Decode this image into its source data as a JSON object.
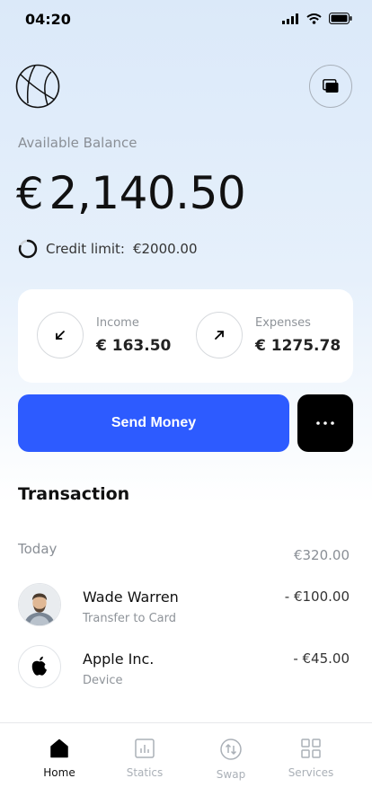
{
  "status_bar": {
    "time": "04:20"
  },
  "header": {
    "logo_icon": "globe-icon",
    "cards_icon": "cards-icon"
  },
  "balance": {
    "label": "Available Balance",
    "currency": "€",
    "amount": "2,140.50"
  },
  "credit": {
    "label": "Credit limit:",
    "value": "€2000.00",
    "progress_fraction": 0.8
  },
  "summary": {
    "income": {
      "label": "Income",
      "value": "€ 163.50",
      "icon": "arrow-down-left-icon"
    },
    "expenses": {
      "label": "Expenses",
      "value": "€ 1275.78",
      "icon": "arrow-up-right-icon"
    }
  },
  "actions": {
    "send_label": "Send Money",
    "more_icon": "more-dots-icon",
    "accent_color": "#2d5bff"
  },
  "transactions": {
    "title": "Transaction",
    "day_label": "Today",
    "day_total": "€320.00",
    "items": [
      {
        "name": "Wade Warren",
        "subtitle": "Transfer to Card",
        "amount": "- €100.00",
        "icon": "person-avatar"
      },
      {
        "name": "Apple Inc.",
        "subtitle": "Device",
        "amount": "- €45.00",
        "icon": "apple-icon"
      }
    ]
  },
  "nav": {
    "items": [
      {
        "label": "Home",
        "icon": "home-icon",
        "active": true
      },
      {
        "label": "Statics",
        "icon": "chart-icon",
        "active": false
      },
      {
        "label": "Swap",
        "icon": "swap-icon",
        "active": false
      },
      {
        "label": "Services",
        "icon": "grid-icon",
        "active": false
      }
    ]
  }
}
